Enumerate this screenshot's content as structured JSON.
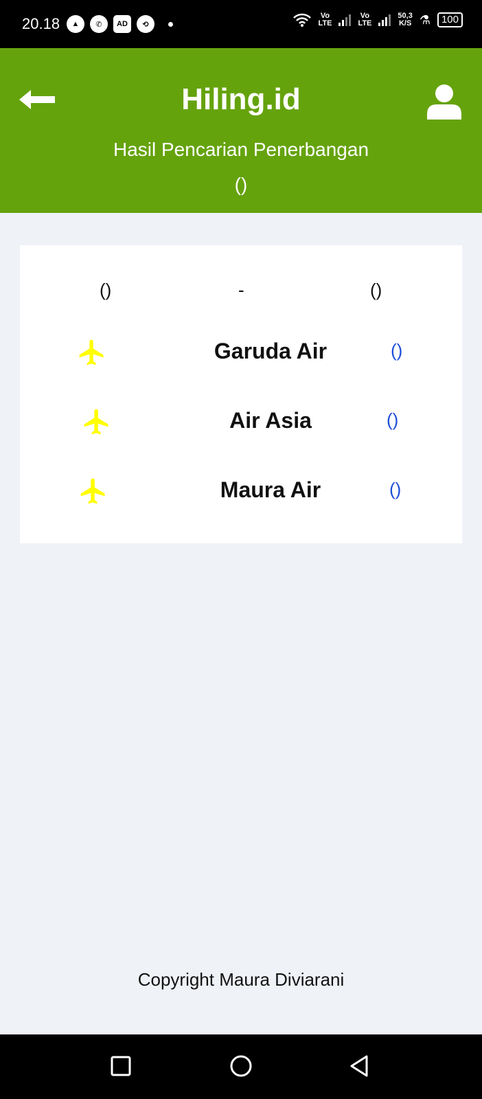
{
  "status_bar": {
    "time": "20.18",
    "net_top": "Vo",
    "net_bottom": "LTE",
    "speed_top": "50,3",
    "speed_bottom": "K/S",
    "battery": "100"
  },
  "header": {
    "brand": "Hiling.id",
    "subtitle": "Hasil Pencarian Penerbangan",
    "date": "()",
    "color": "#65a30d"
  },
  "route": {
    "from": "()",
    "separator": "-",
    "to": "()"
  },
  "flights": [
    {
      "airline": "Garuda Air",
      "price": "()"
    },
    {
      "airline": "Air Asia",
      "price": "()"
    },
    {
      "airline": "Maura Air",
      "price": "()"
    }
  ],
  "footer": {
    "copyright": "Copyright Maura Diviarani"
  },
  "icons": {
    "back": "arrow-left-icon",
    "user": "user-icon",
    "plane": "airplane-icon",
    "plane_color": "#ffff00"
  }
}
